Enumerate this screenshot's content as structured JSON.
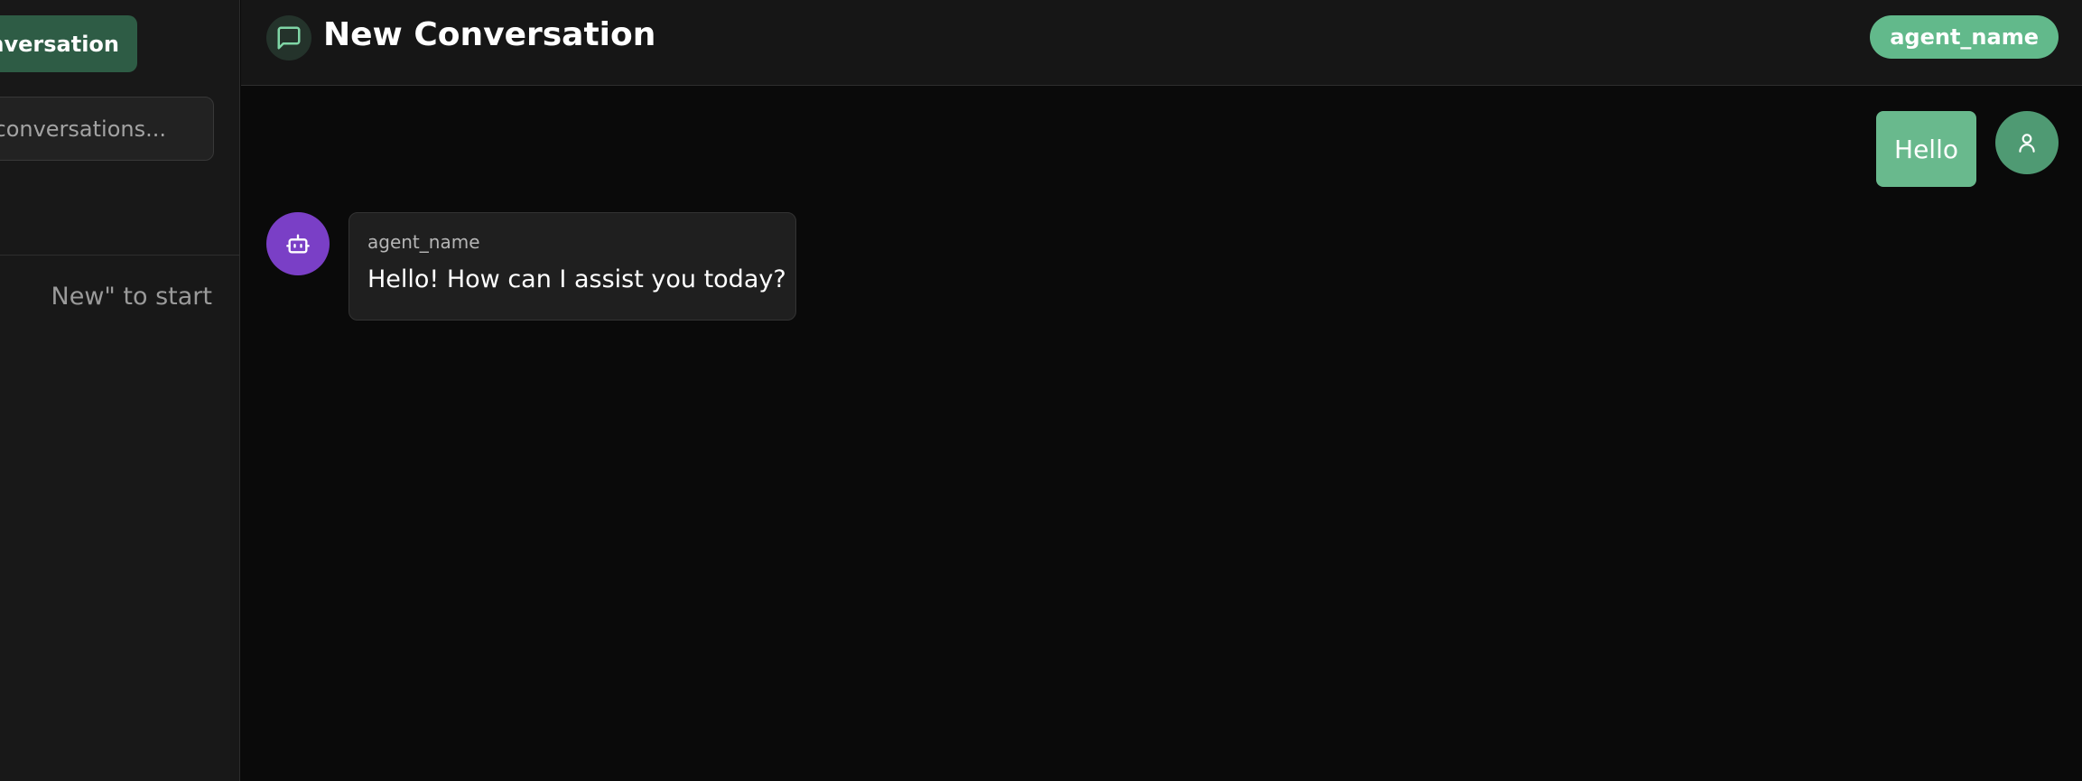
{
  "sidebar": {
    "new_button_label": "onversation",
    "search_placeholder": "conversations...",
    "empty_hint": "New\" to start"
  },
  "header": {
    "title": "New Conversation",
    "agent_pill": "agent_name",
    "icon": "chat-bubble-icon"
  },
  "messages": [
    {
      "role": "user",
      "text": "Hello",
      "avatar_icon": "user-icon"
    },
    {
      "role": "assistant",
      "sender": "agent_name",
      "text": "Hello! How can I assist you today?",
      "avatar_icon": "bot-icon"
    }
  ],
  "colors": {
    "accent": "#62b98b",
    "new_button_bg": "#2e5c45",
    "bot_avatar": "#7a3fc6",
    "background": "#0a0a0a"
  }
}
